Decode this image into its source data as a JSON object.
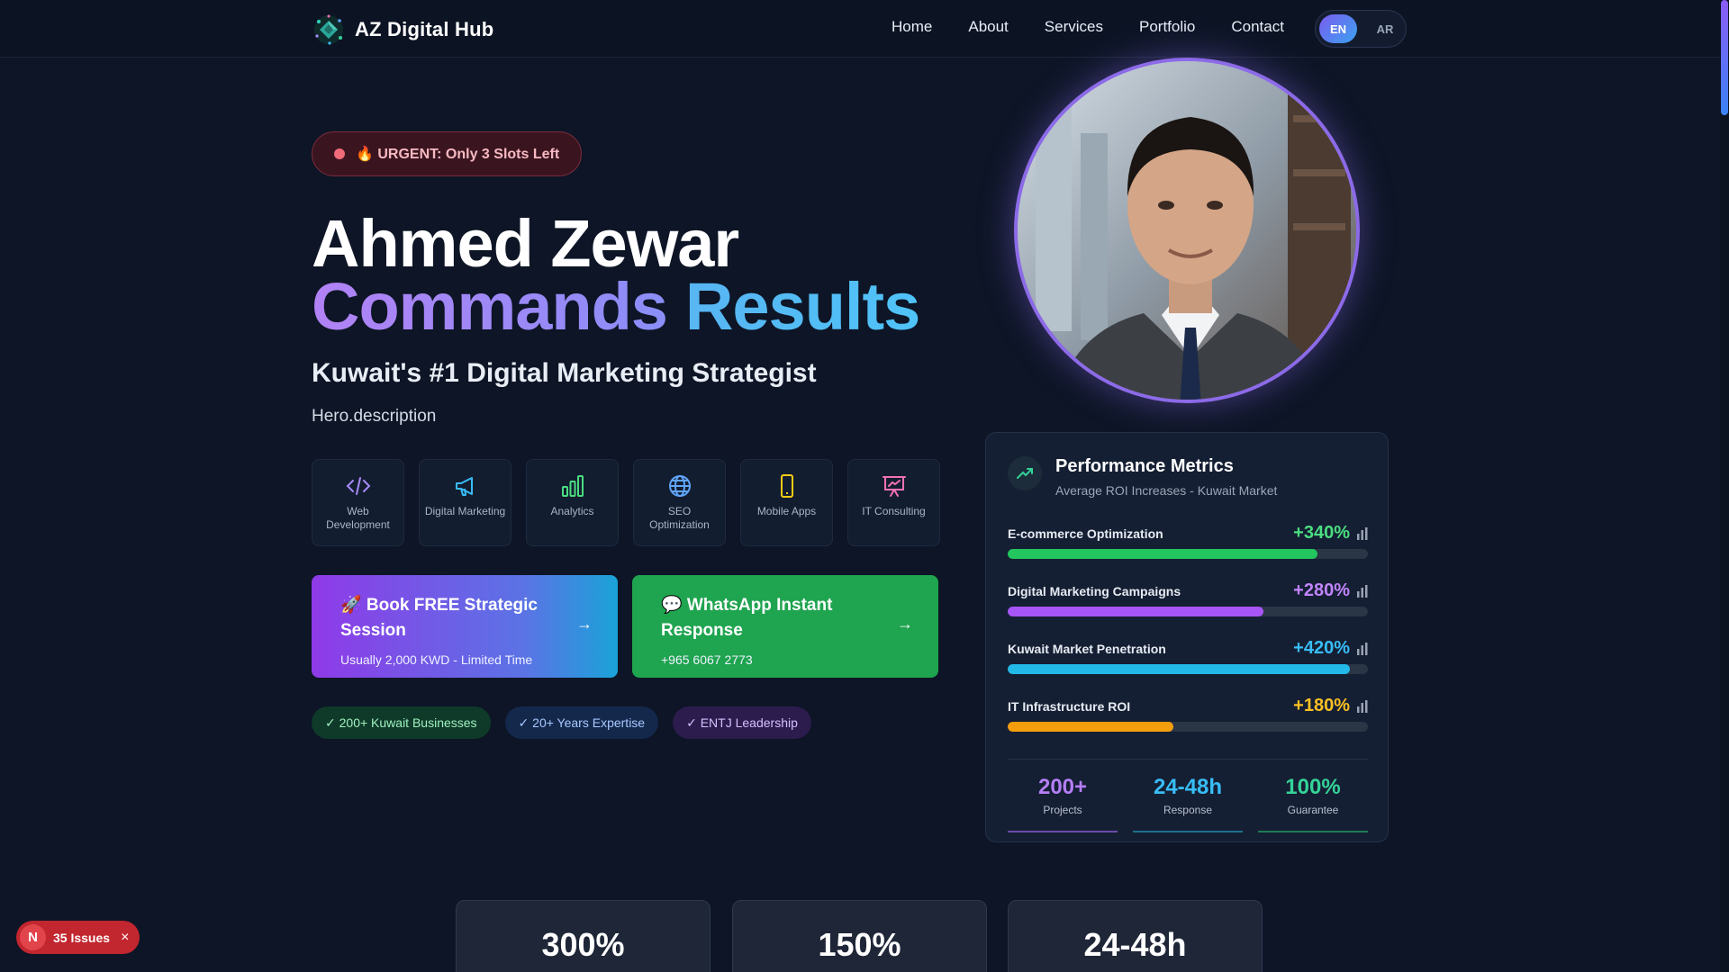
{
  "nav": {
    "brand": "AZ Digital Hub",
    "links": [
      "Home",
      "About",
      "Services",
      "Portfolio",
      "Contact"
    ],
    "lang": {
      "en": "EN",
      "ar": "AR",
      "active": "EN"
    }
  },
  "hero": {
    "urgent": "🔥 URGENT: Only 3 Slots Left",
    "name": "Ahmed Zewar",
    "headline_1": "Commands",
    "headline_2": "Results",
    "subtitle": "Kuwait's #1 Digital Marketing Strategist",
    "description": "Hero.description",
    "services": [
      {
        "label": "Web Development",
        "icon": "code-icon"
      },
      {
        "label": "Digital Marketing",
        "icon": "megaphone-icon"
      },
      {
        "label": "Analytics",
        "icon": "bar-chart-icon"
      },
      {
        "label": "SEO Optimization",
        "icon": "globe-icon"
      },
      {
        "label": "Mobile Apps",
        "icon": "smartphone-icon"
      },
      {
        "label": "IT Consulting",
        "icon": "presentation-icon"
      }
    ],
    "cta_book": {
      "title": "🚀 Book FREE Strategic Session",
      "sub": "Usually 2,000 KWD - Limited Time",
      "arrow": "→"
    },
    "cta_whatsapp": {
      "title": "💬 WhatsApp Instant Response",
      "sub": "+965 6067 2773",
      "arrow": "→"
    },
    "badges": [
      "✓ 200+ Kuwait Businesses",
      "✓ 20+ Years Expertise",
      "✓ ENTJ Leadership"
    ]
  },
  "metrics": {
    "title": "Performance Metrics",
    "subtitle": "Average ROI Increases - Kuwait Market",
    "rows": [
      {
        "label": "E-commerce Optimization",
        "value": "+340%",
        "fill_pct": 86,
        "color": "#22c55e"
      },
      {
        "label": "Digital Marketing Campaigns",
        "value": "+280%",
        "fill_pct": 71,
        "color": "#a855f7"
      },
      {
        "label": "Kuwait Market Penetration",
        "value": "+420%",
        "fill_pct": 95,
        "color": "#22b8e8"
      },
      {
        "label": "IT Infrastructure ROI",
        "value": "+180%",
        "fill_pct": 46,
        "color": "#f59e0b"
      }
    ],
    "stats": [
      {
        "value": "200+",
        "label": "Projects",
        "color": "#b57ef7"
      },
      {
        "value": "24-48h",
        "label": "Response",
        "color": "#38bdf8"
      },
      {
        "value": "100%",
        "label": "Guarantee",
        "color": "#34d399"
      }
    ]
  },
  "bottom_stats": [
    "300%",
    "150%",
    "24-48h"
  ],
  "issues": {
    "badge": "N",
    "text": "35 Issues",
    "close": "×"
  }
}
